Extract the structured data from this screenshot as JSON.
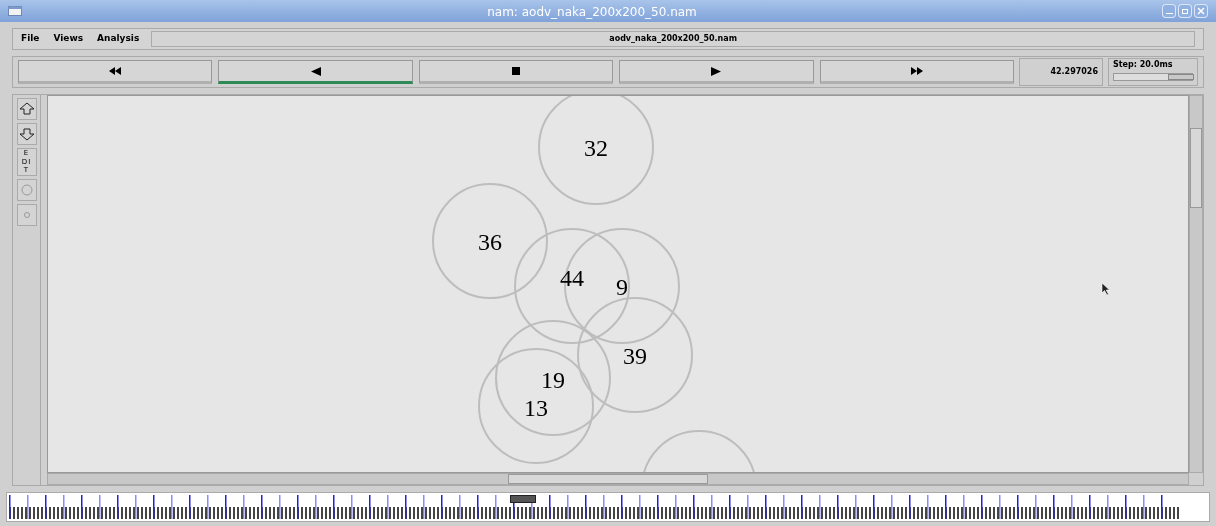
{
  "window": {
    "title": "nam: aodv_naka_200x200_50.nam"
  },
  "menu": [
    "File",
    "Views",
    "Analysis"
  ],
  "file_label": "aodv_naka_200x200_50.nam",
  "controls": [
    {
      "kind": "rewind",
      "selected": false
    },
    {
      "kind": "back",
      "selected": true
    },
    {
      "kind": "stop",
      "selected": false
    },
    {
      "kind": "play",
      "selected": false
    },
    {
      "kind": "forward",
      "selected": false
    }
  ],
  "time": "42.297026",
  "step": {
    "label": "Step: 20.0ms",
    "level": 0.8
  },
  "tools": [
    {
      "kind": "zoom-in"
    },
    {
      "kind": "zoom-out"
    },
    {
      "kind": "edit",
      "label": "EDIT"
    },
    {
      "kind": "big-circle"
    },
    {
      "kind": "small-circle"
    }
  ],
  "nodes": [
    {
      "kind": "node",
      "label": "32"
    },
    {
      "kind": "node",
      "label": "36"
    },
    {
      "kind": "node",
      "label": "44"
    },
    {
      "kind": "node",
      "label": "9"
    },
    {
      "kind": "node",
      "label": "39"
    },
    {
      "kind": "node",
      "label": "19"
    },
    {
      "kind": "node",
      "label": "13"
    },
    {
      "kind": "node"
    }
  ]
}
